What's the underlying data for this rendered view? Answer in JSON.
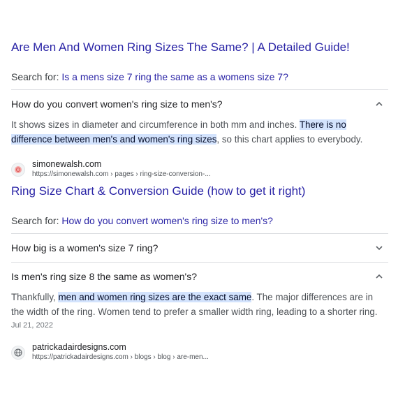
{
  "result1": {
    "title": "Are Men And Women Ring Sizes The Same? | A Detailed Guide!",
    "search_for_label": "Search for: ",
    "search_for_query": "Is a mens size 7 ring the same as a womens size 7?",
    "question": "How do you convert women's ring size to men's?",
    "answer_pre": "It shows sizes in diameter and circumference in both mm and inches. ",
    "answer_highlight": "There is no difference between men's and women's ring sizes",
    "answer_post": ", so this chart applies to everybody.",
    "source_name": "simonewalsh.com",
    "source_url": "https://simonewalsh.com › pages › ring-size-conversion-..."
  },
  "result2": {
    "title": "Ring Size Chart & Conversion Guide (how to get it right)",
    "search_for_label": "Search for: ",
    "search_for_query": "How do you convert women's ring size to men's?",
    "question1": "How big is a women's size 7 ring?",
    "question2": "Is men's ring size 8 the same as women's?",
    "answer_pre": "Thankfully, ",
    "answer_highlight": "men and women ring sizes are the exact same",
    "answer_post": ". The major differences are in the width of the ring. Women tend to prefer a smaller width ring, leading to a shorter ring.",
    "date": "Jul 21, 2022",
    "source_name": "patrickadairdesigns.com",
    "source_url": "https://patrickadairdesigns.com › blogs › blog › are-men..."
  },
  "icons": {
    "chevron_up": "chevron-up-icon",
    "chevron_down": "chevron-down-icon",
    "favicon_1": "rose-favicon-icon",
    "favicon_2": "globe-icon"
  },
  "colors": {
    "link": "#2a24a6",
    "highlight": "#d3e3fd",
    "divider": "#dadce0"
  }
}
